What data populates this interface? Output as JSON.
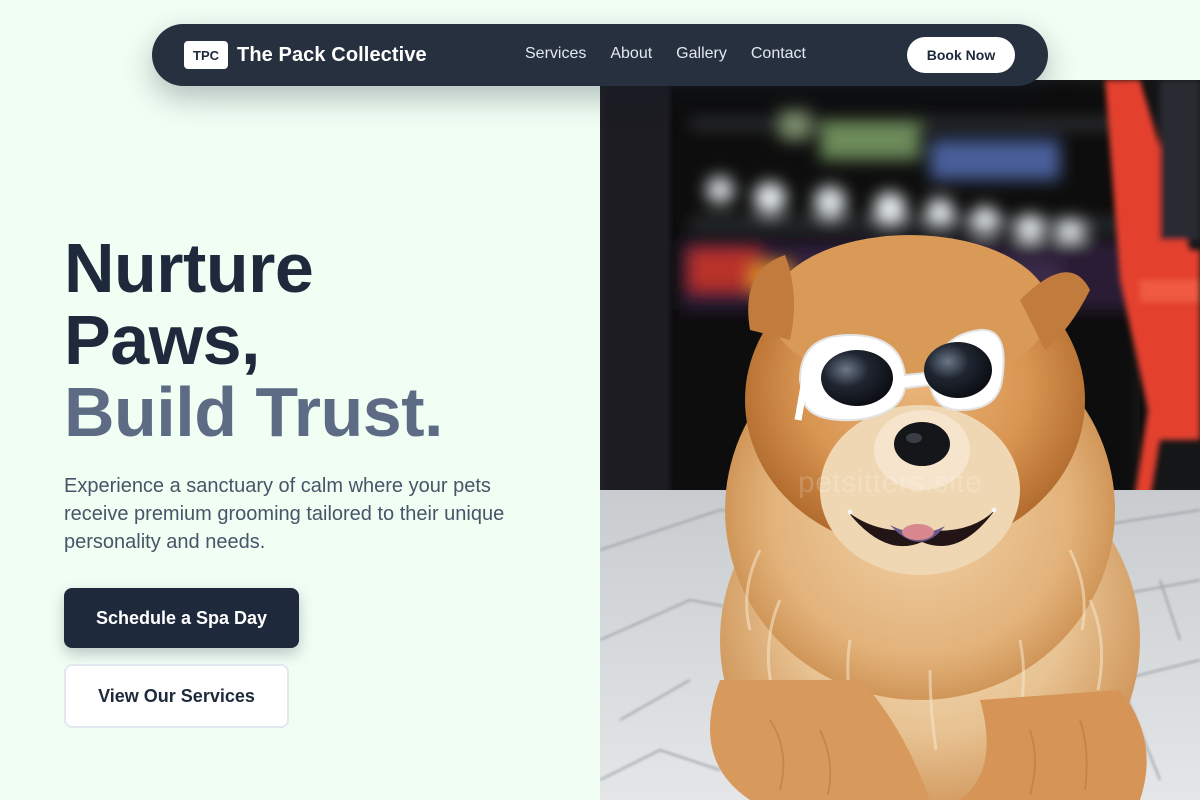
{
  "nav": {
    "logo_badge": "TPC",
    "brand_name": "The Pack Collective",
    "links": [
      "Services",
      "About",
      "Gallery",
      "Contact"
    ],
    "cta": "Book Now"
  },
  "hero": {
    "headline_line1": "Nurture",
    "headline_line2": "Paws,",
    "headline_line3": "Build Trust.",
    "subtext": "Experience a sanctuary of calm where your pets receive premium grooming tailored to their unique personality and needs.",
    "primary_cta": "Schedule a Spa Day",
    "secondary_cta": "View Our Services",
    "image_watermark": "petsitters.site"
  },
  "colors": {
    "background": "#f0fef4",
    "navbar": "#27303f",
    "primary": "#1e293b",
    "headline_accent": "#5d6b84",
    "body_text": "#475569"
  }
}
